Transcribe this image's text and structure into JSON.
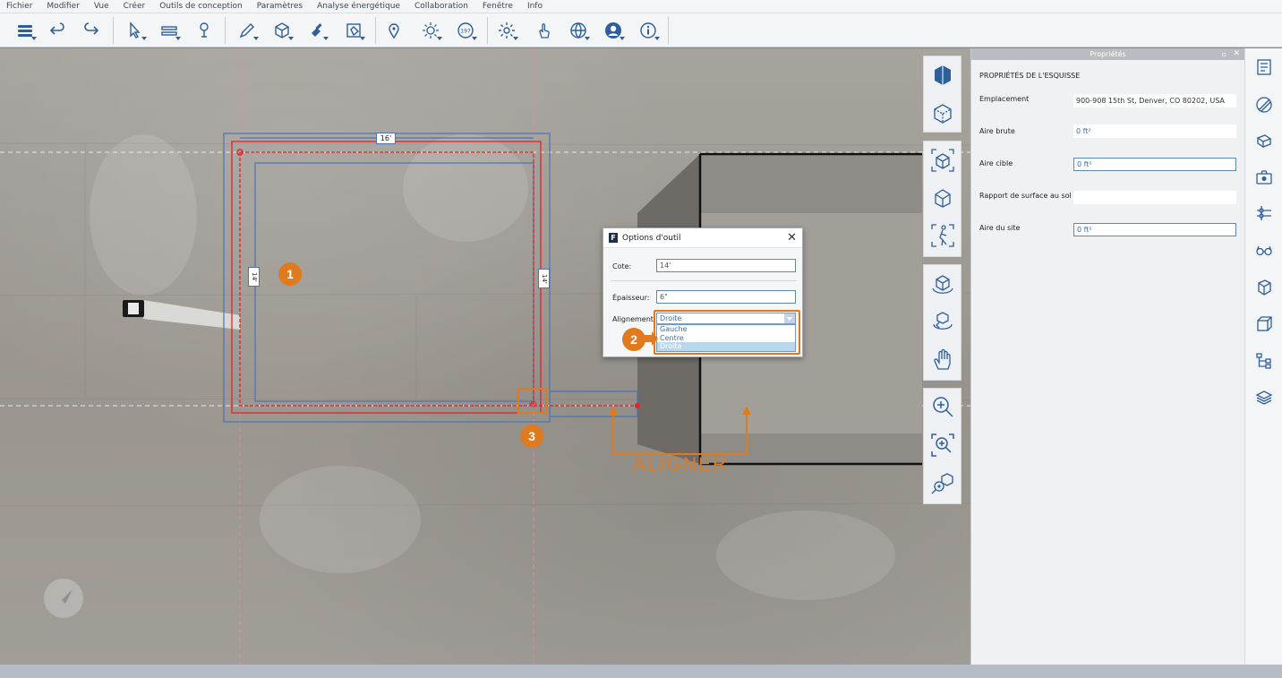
{
  "menu": [
    "Fichier",
    "Modifier",
    "Vue",
    "Créer",
    "Outils de conception",
    "Paramètres",
    "Analyse énergétique",
    "Collaboration",
    "Fenêtre",
    "Info"
  ],
  "toolbar_icons": [
    "menu-icon",
    "undo-icon",
    "redo-icon",
    "select-icon",
    "wall-icon",
    "pin-tool-icon",
    "pencil-icon",
    "box-icon",
    "paint-icon",
    "boundary-icon",
    "location-icon",
    "sun-icon",
    "date-icon",
    "gear-icon",
    "touch-icon",
    "globe-icon",
    "user-icon",
    "info-icon"
  ],
  "dimensions": {
    "top": "16'",
    "left": "14'",
    "right": "14'"
  },
  "dialog": {
    "title": "Options d'outil",
    "cote_label": "Cote:",
    "cote_value": "14'",
    "epaisseur_label": "Épaisseur:",
    "epaisseur_value": "6\"",
    "alignement_label": "Alignement:",
    "alignement_value": "Droite",
    "options": [
      "Gauche",
      "Centre",
      "Droite"
    ],
    "selected_option": "Droite"
  },
  "callouts": {
    "one": "1",
    "two": "2",
    "three": "3",
    "aligner": "ALIGNER"
  },
  "properties": {
    "header": "Propriétés",
    "section": "PROPRIÉTÉS DE L'ESQUISSE",
    "rows": [
      {
        "label": "Emplacement",
        "value": "900-908 15th St, Denver, CO 80202, USA"
      },
      {
        "label": "Aire brute",
        "value": "0 ft²"
      },
      {
        "label": "Aire cible",
        "value": "0 ft²"
      },
      {
        "label": "Rapport de surface au sol",
        "value": ""
      },
      {
        "label": "Aire du site",
        "value": "0 ft²"
      }
    ]
  },
  "view_tools": [
    "3d-view-icon",
    "top-view-icon",
    "home-view-icon",
    "view-cube-icon",
    "walk-icon",
    "orbit-icon",
    "rotate-icon",
    "pan-hand-icon",
    "zoom-in-icon",
    "zoom-window-icon",
    "zoom-extents-icon"
  ],
  "side_tools": [
    "properties-icon",
    "materials-icon",
    "layers-icon",
    "camera-icon",
    "levels-icon",
    "glasses-icon",
    "box-face-icon",
    "cube-outline-icon",
    "hierarchy-icon",
    "stack-icon"
  ],
  "colors": {
    "accent": "#e07a1f",
    "blue": "#3a6ea8",
    "red": "#e0242b"
  }
}
